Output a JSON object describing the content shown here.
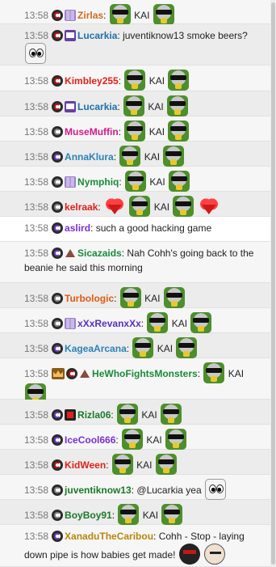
{
  "messages": [
    {
      "time": "13:58",
      "badges": [
        "badge-cap badge-red",
        "badge-prime"
      ],
      "user": "Zirlas",
      "color": "#d2691e",
      "parts": [
        [
          "emote",
          "kai"
        ],
        [
          "text",
          "KAI"
        ],
        [
          "emote",
          "kai"
        ]
      ]
    },
    {
      "time": "13:58",
      "badges": [
        "badge-cap badge-red",
        "badge-tv"
      ],
      "user": "Lucarkia",
      "color": "#1f6fa6",
      "parts": [
        [
          "text",
          "juventiknow13 smoke beers?"
        ],
        [
          "emote",
          "eyes"
        ]
      ]
    },
    {
      "time": "13:58",
      "badges": [
        "badge-cap badge-red"
      ],
      "user": "Kimbley255",
      "color": "#e0201a",
      "parts": [
        [
          "emote",
          "kai"
        ],
        [
          "text",
          "KAI"
        ],
        [
          "emote",
          "kai"
        ]
      ]
    },
    {
      "time": "13:58",
      "badges": [
        "badge-cap badge-red",
        "badge-tv"
      ],
      "user": "Lucarkia",
      "color": "#1f6fa6",
      "parts": [
        [
          "emote",
          "kai"
        ],
        [
          "text",
          "KAI"
        ],
        [
          "emote",
          "kai"
        ]
      ]
    },
    {
      "time": "13:58",
      "badges": [
        "badge-cap badge-grey"
      ],
      "user": "MuseMuffin",
      "color": "#d01c8b",
      "parts": [
        [
          "emote",
          "kai"
        ],
        [
          "text",
          "KAI"
        ],
        [
          "emote",
          "kai"
        ]
      ]
    },
    {
      "time": "13:58",
      "badges": [
        "badge-cap badge-purple"
      ],
      "user": "AnnaKlura",
      "color": "#2a82b8",
      "parts": [
        [
          "emote",
          "kai"
        ],
        [
          "text",
          "KAI"
        ],
        [
          "emote",
          "kai"
        ]
      ]
    },
    {
      "time": "13:58",
      "badges": [
        "badge-cap badge-grey",
        "badge-prime"
      ],
      "user": "Nymphiq",
      "color": "#1a8a3a",
      "parts": [
        [
          "emote",
          "kai"
        ],
        [
          "text",
          "KAI"
        ],
        [
          "emote",
          "kai"
        ]
      ]
    },
    {
      "time": "13:58",
      "badges": [
        "badge-cap badge-grey"
      ],
      "user": "kelraak",
      "color": "#e0201a",
      "parts": [
        [
          "emote",
          "heart"
        ],
        [
          "emote",
          "kai"
        ],
        [
          "text",
          "KAI"
        ],
        [
          "emote",
          "kai"
        ],
        [
          "emote",
          "heart"
        ]
      ]
    },
    {
      "time": "13:58",
      "badges": [
        "badge-cap badge-purple"
      ],
      "user": "aslird",
      "color": "#7a2fd0",
      "parts": [
        [
          "text",
          "such a good hacking game"
        ]
      ]
    },
    {
      "time": "13:58",
      "badges": [
        "badge-cap badge-purple",
        "badge-turtle"
      ],
      "user": "Sicazaids",
      "color": "#1a8a3a",
      "parts": [
        [
          "text",
          "Nah Cohh's going back to the beanie he said this morning"
        ]
      ]
    },
    {
      "time": "13:58",
      "badges": [
        "badge-cap badge-grey"
      ],
      "user": "Turbologic",
      "color": "#e05a10",
      "parts": [
        [
          "emote",
          "kai"
        ],
        [
          "text",
          "KAI"
        ],
        [
          "emote",
          "kai"
        ]
      ]
    },
    {
      "time": "13:58",
      "badges": [
        "badge-cap badge-grey",
        "badge-prime"
      ],
      "user": "xXxRevanxXx",
      "color": "#5a2fc0",
      "parts": [
        [
          "emote",
          "kai"
        ],
        [
          "text",
          "KAI"
        ],
        [
          "emote",
          "kai"
        ]
      ]
    },
    {
      "time": "13:58",
      "badges": [
        "badge-cap badge-purple"
      ],
      "user": "KageaArcana",
      "color": "#2a82b8",
      "parts": [
        [
          "emote",
          "kai"
        ],
        [
          "text",
          "KAI"
        ],
        [
          "emote",
          "kai"
        ]
      ]
    },
    {
      "time": "13:58",
      "badges": [
        "badge-crown",
        "badge-cap badge-red",
        "badge-turtle"
      ],
      "user": "HeWhoFightsMonsters",
      "color": "#1a8a3a",
      "parts": [
        [
          "emote",
          "kai"
        ],
        [
          "text",
          "KAI"
        ],
        [
          "emote",
          "kai"
        ]
      ]
    },
    {
      "time": "13:58",
      "badges": [
        "badge-cap badge-purple",
        "badge-mod"
      ],
      "user": "Rizla06",
      "color": "#1a7a2a",
      "parts": [
        [
          "emote",
          "kai"
        ],
        [
          "text",
          "KAI"
        ],
        [
          "emote",
          "kai"
        ]
      ]
    },
    {
      "time": "13:58",
      "badges": [
        "badge-cap badge-purple"
      ],
      "user": "IceCool666",
      "color": "#7a2fd0",
      "parts": [
        [
          "emote",
          "kai"
        ],
        [
          "text",
          "KAI"
        ],
        [
          "emote",
          "kai"
        ]
      ]
    },
    {
      "time": "13:58",
      "badges": [
        "badge-cap badge-red"
      ],
      "user": "KidWeen",
      "color": "#e0201a",
      "parts": [
        [
          "emote",
          "kai"
        ],
        [
          "text",
          "KAI"
        ],
        [
          "emote",
          "kai"
        ]
      ]
    },
    {
      "time": "13:58",
      "badges": [
        "badge-cap badge-grey"
      ],
      "user": "juventiknow13",
      "color": "#1a7a2a",
      "parts": [
        [
          "text",
          "@Lucarkia yea"
        ],
        [
          "emote",
          "eyes"
        ]
      ]
    },
    {
      "time": "13:58",
      "badges": [
        "badge-cap badge-grey"
      ],
      "user": "BoyBoy91",
      "color": "#1a7a2a",
      "parts": [
        [
          "emote",
          "kai"
        ],
        [
          "text",
          "KAI"
        ],
        [
          "emote",
          "kai"
        ]
      ]
    },
    {
      "time": "13:58",
      "badges": [
        "badge-cap badge-purple"
      ],
      "user": "XanaduTheCaribou",
      "color": "#b8860b",
      "parts": [
        [
          "text",
          "Cohh - Stop - laying down pipe is how babies get made!"
        ],
        [
          "emote",
          "pipe"
        ],
        [
          "emote",
          "face"
        ]
      ]
    }
  ]
}
